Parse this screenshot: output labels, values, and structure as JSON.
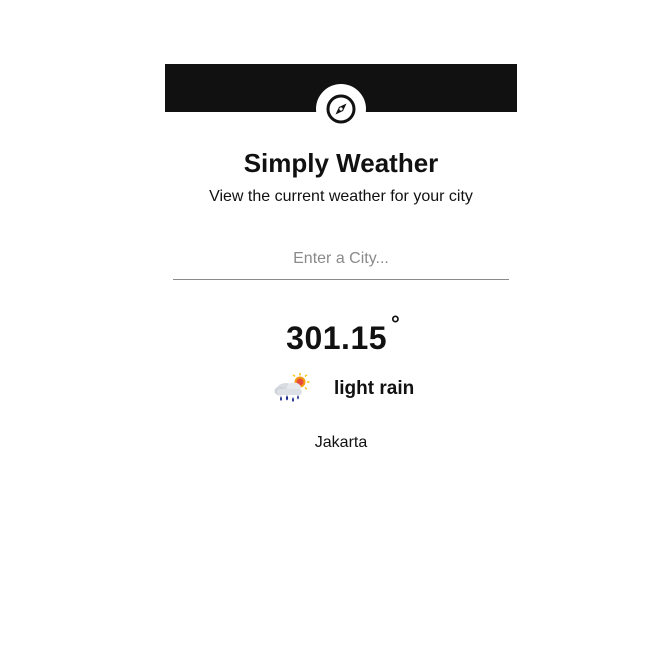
{
  "app": {
    "title": "Simply Weather",
    "subtitle": "View the current weather for your city",
    "logo_icon": "compass-icon"
  },
  "search": {
    "placeholder": "Enter a City...",
    "value": ""
  },
  "weather": {
    "temperature": "301.15",
    "degree_symbol": "°",
    "condition": "light rain",
    "condition_icon": "light-rain-sun-icon",
    "city": "Jakarta"
  },
  "colors": {
    "header_bar": "#111111",
    "background": "#ffffff",
    "text": "#111111",
    "placeholder": "#8a8a8a"
  }
}
